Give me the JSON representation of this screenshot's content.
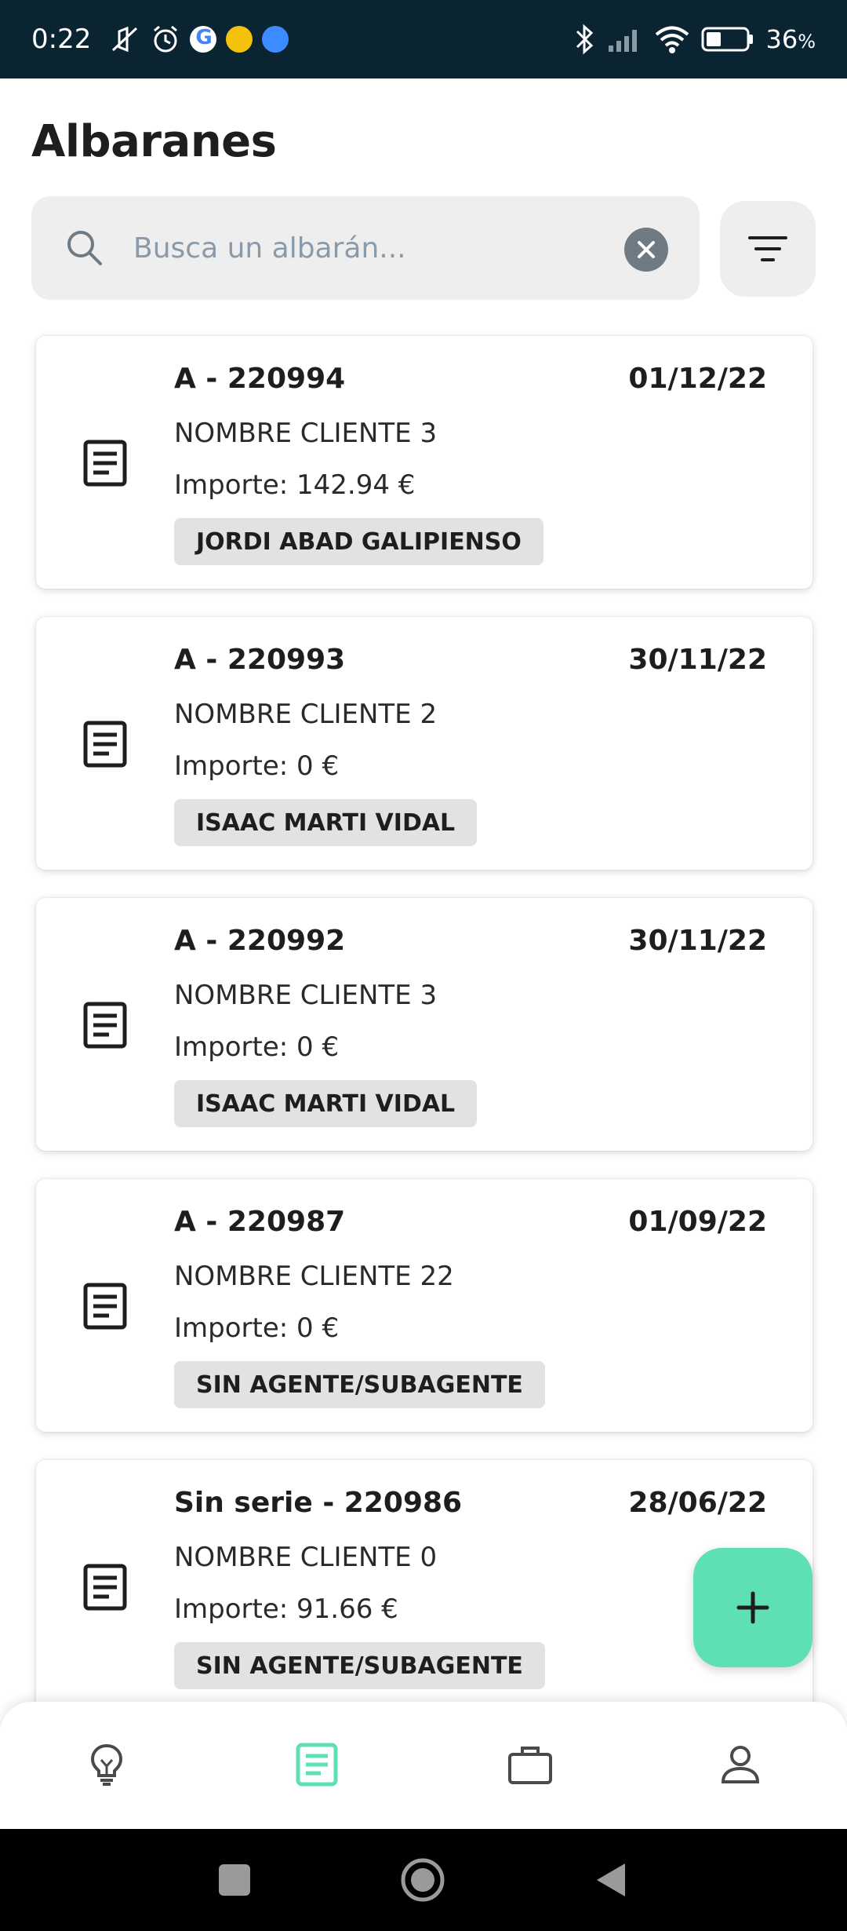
{
  "status_bar": {
    "time": "0:22",
    "battery_percent": "36",
    "battery_suffix": "%",
    "icons": [
      "mute-icon",
      "alarm-icon",
      "google-icon",
      "drive-icon",
      "vpn-icon",
      "bluetooth-icon",
      "signal-icon",
      "wifi-icon",
      "battery-icon"
    ]
  },
  "header": {
    "title": "Albaranes"
  },
  "search": {
    "placeholder": "Busca un albarán...",
    "value": ""
  },
  "albaranes": [
    {
      "number": "A - 220994",
      "date": "01/12/22",
      "client": "NOMBRE CLIENTE 3",
      "amount": "Importe: 142.94 €",
      "agent": "JORDI ABAD GALIPIENSO"
    },
    {
      "number": "A - 220993",
      "date": "30/11/22",
      "client": "NOMBRE CLIENTE 2",
      "amount": "Importe: 0 €",
      "agent": "ISAAC MARTI VIDAL"
    },
    {
      "number": "A - 220992",
      "date": "30/11/22",
      "client": "NOMBRE CLIENTE 3",
      "amount": "Importe: 0 €",
      "agent": "ISAAC MARTI VIDAL"
    },
    {
      "number": "A - 220987",
      "date": "01/09/22",
      "client": "NOMBRE CLIENTE 22",
      "amount": "Importe: 0 €",
      "agent": "SIN AGENTE/SUBAGENTE"
    },
    {
      "number": "Sin serie - 220986",
      "date": "28/06/22",
      "client": "NOMBRE CLIENTE 0",
      "amount": "Importe: 91.66 €",
      "agent": "SIN AGENTE/SUBAGENTE"
    }
  ],
  "bottom_nav": {
    "items": [
      {
        "icon": "lightbulb-icon",
        "active": false
      },
      {
        "icon": "document-icon",
        "active": true
      },
      {
        "icon": "briefcase-icon",
        "active": false
      },
      {
        "icon": "user-icon",
        "active": false
      }
    ]
  },
  "colors": {
    "status_bar": "#0b2432",
    "accent": "#5ee0b4",
    "search_bg": "#eeeeee",
    "chip_bg": "#e2e2e2",
    "icon_inactive": "#4a4a4a"
  }
}
